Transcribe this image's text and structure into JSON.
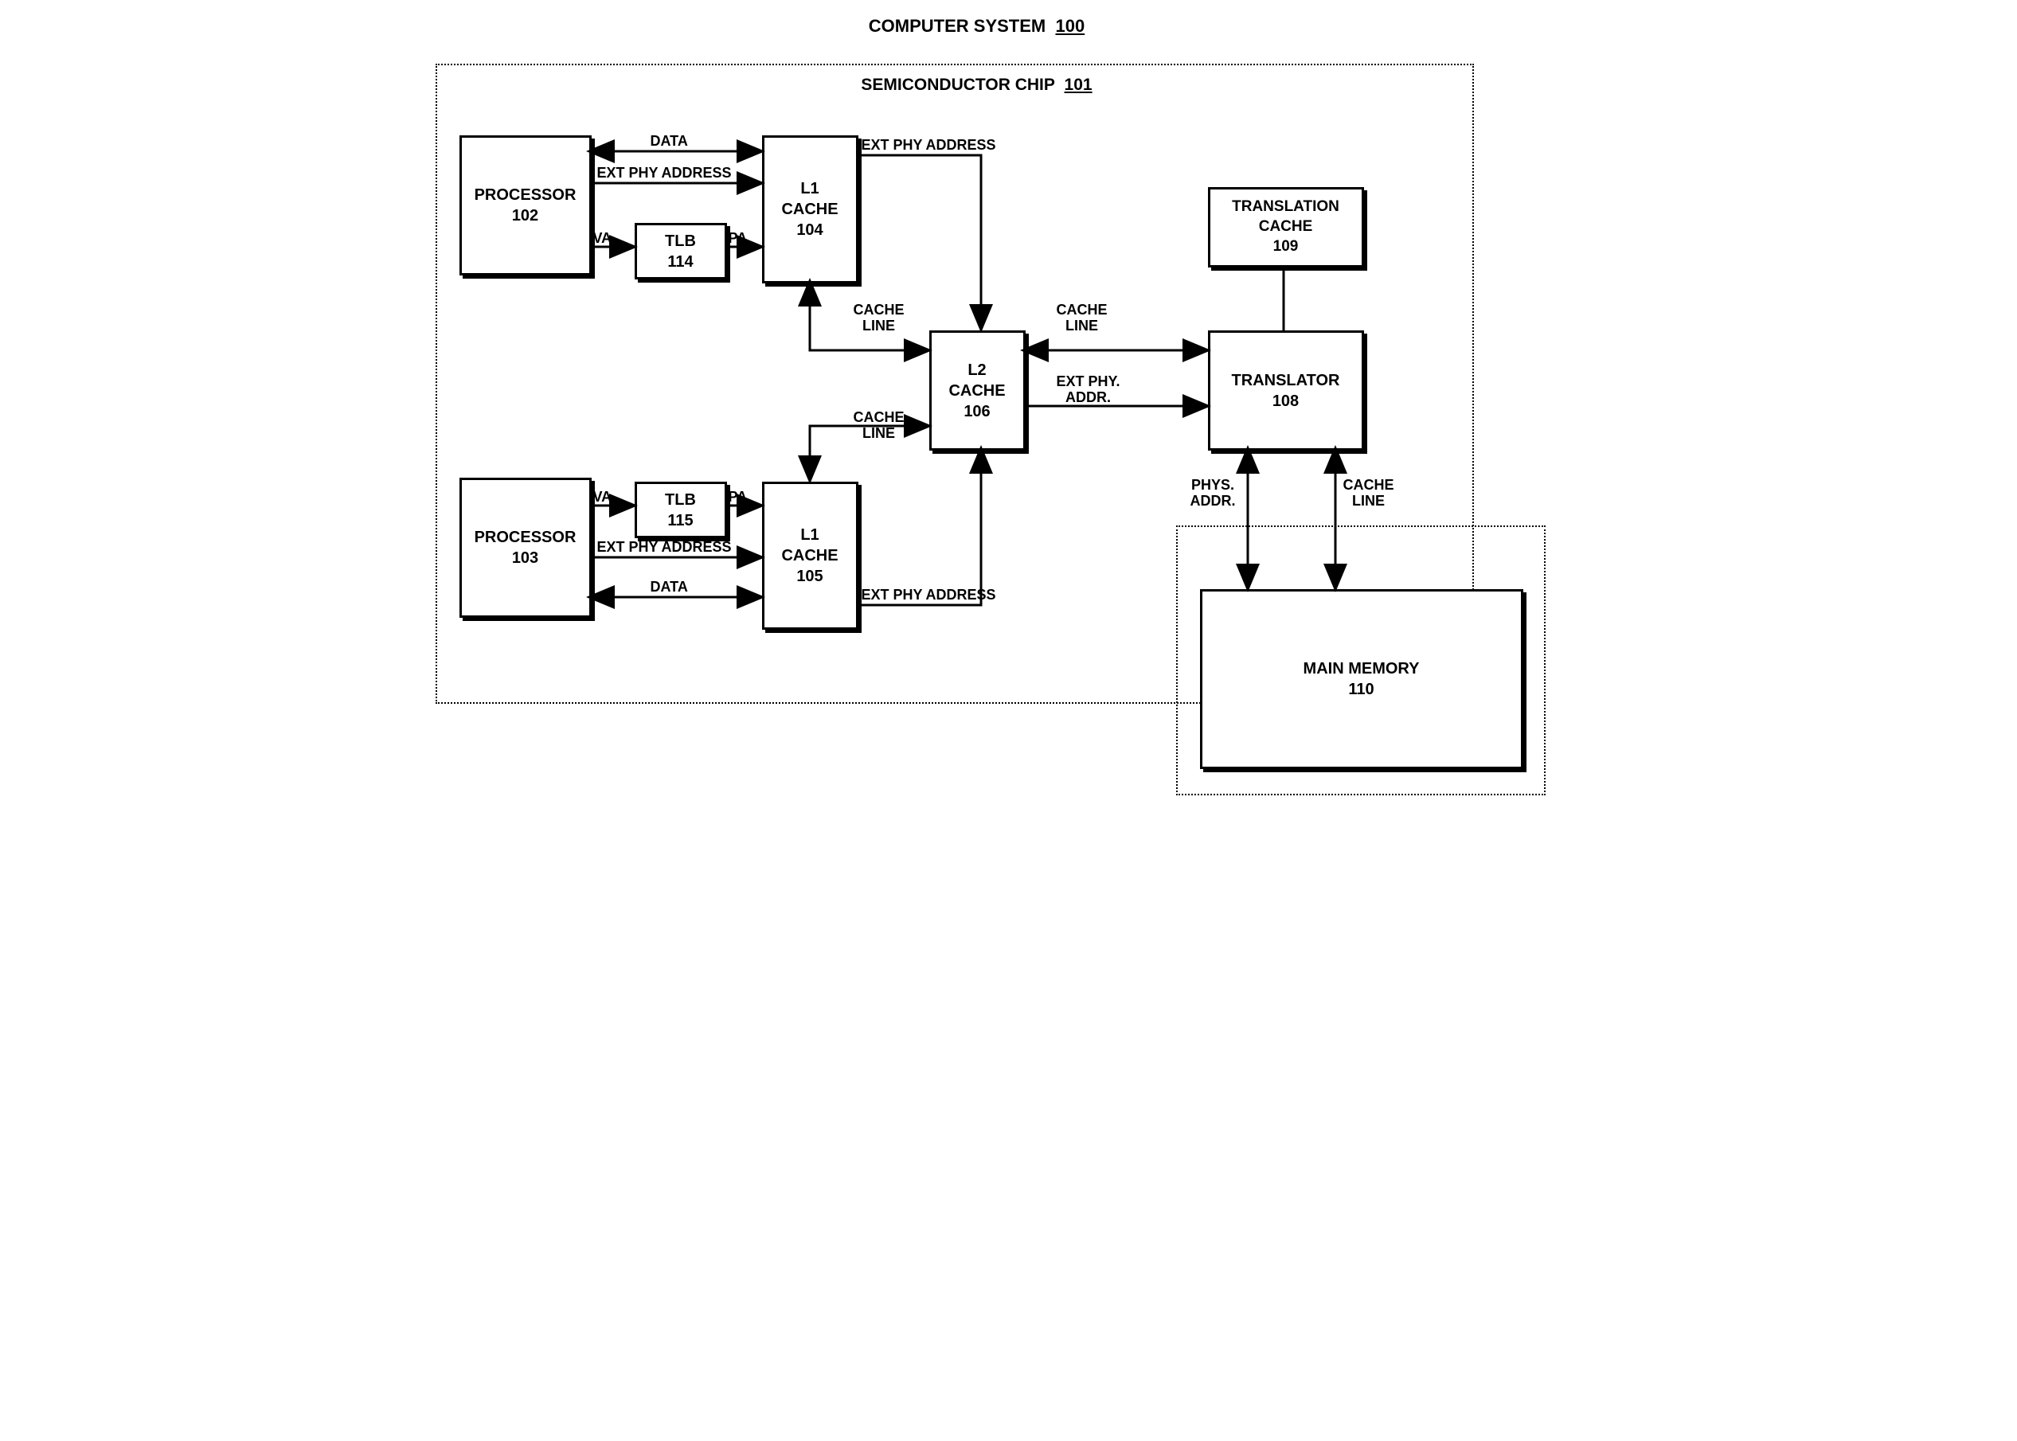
{
  "diagram": {
    "title_text": "COMPUTER SYSTEM",
    "title_num": "100",
    "chip_label_text": "SEMICONDUCTOR CHIP",
    "chip_label_num": "101",
    "blocks": {
      "processor_a": {
        "name": "PROCESSOR",
        "num": "102"
      },
      "processor_b": {
        "name": "PROCESSOR",
        "num": "103"
      },
      "tlb_a": {
        "name": "TLB",
        "num": "114"
      },
      "tlb_b": {
        "name": "TLB",
        "num": "115"
      },
      "l1_a": {
        "name": "L1 CACHE",
        "num": "104"
      },
      "l1_b": {
        "name": "L1 CACHE",
        "num": "105"
      },
      "l2": {
        "name": "L2 CACHE",
        "num": "106"
      },
      "translator": {
        "name": "TRANSLATOR",
        "num": "108"
      },
      "trans_cache": {
        "name": "TRANSLATION CACHE",
        "num": "109"
      },
      "main_mem": {
        "name": "MAIN MEMORY",
        "num": "110"
      }
    },
    "labels": {
      "data": "DATA",
      "ext_phy_address": "EXT PHY ADDRESS",
      "va": "VA",
      "pa": "PA",
      "cache_line": "CACHE LINE",
      "cache_line_ml": "CACHE\nLINE",
      "ext_phy_addr_ml": "EXT PHY.\nADDR.",
      "phys_addr_ml": "PHYS.\nADDR."
    }
  }
}
